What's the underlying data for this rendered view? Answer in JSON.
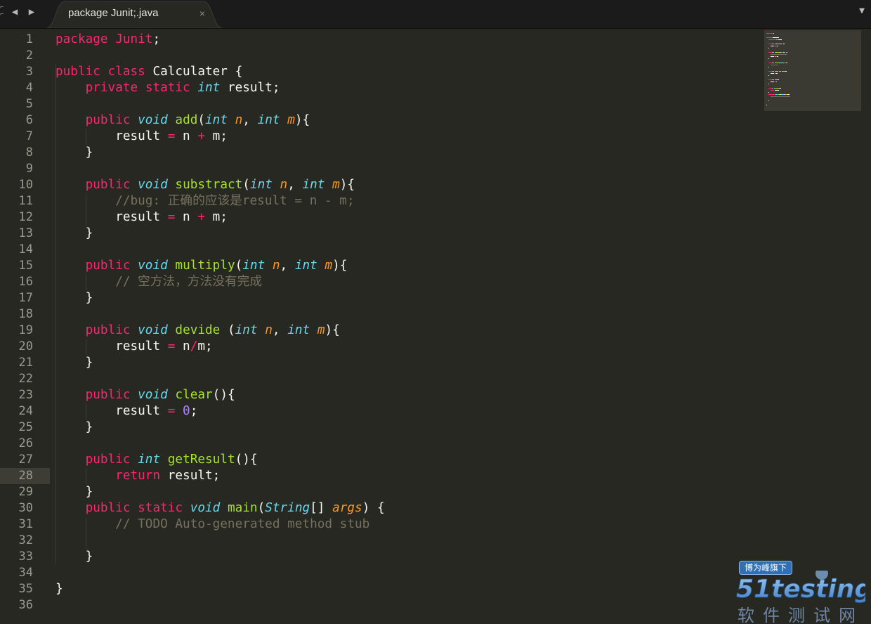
{
  "tab": {
    "title": "package Junit;.java",
    "close_glyph": "×",
    "prev_glyph": "◀",
    "next_glyph": "▶",
    "menu_glyph": "▼"
  },
  "editor": {
    "active_line": 28,
    "colors": {
      "background": "#272822",
      "keyword": "#f92672",
      "type": "#66d9ef",
      "function": "#a6e22e",
      "parameter": "#fd971f",
      "number": "#ae81ff",
      "comment": "#75715e",
      "text": "#f8f8f2"
    },
    "lines": [
      {
        "n": "1",
        "tokens": [
          [
            "kw",
            "package "
          ],
          [
            "kw",
            "Junit"
          ],
          [
            "plain",
            ";"
          ]
        ]
      },
      {
        "n": "2",
        "tokens": []
      },
      {
        "n": "3",
        "tokens": [
          [
            "kw",
            "public "
          ],
          [
            "kw",
            "class "
          ],
          [
            "plain",
            "Calculater {"
          ]
        ]
      },
      {
        "n": "4",
        "tokens": [
          [
            "plain",
            "    "
          ],
          [
            "kw",
            "private "
          ],
          [
            "kw",
            "static "
          ],
          [
            "type",
            "int"
          ],
          [
            "plain",
            " result;"
          ]
        ]
      },
      {
        "n": "5",
        "tokens": []
      },
      {
        "n": "6",
        "tokens": [
          [
            "plain",
            "    "
          ],
          [
            "kw",
            "public "
          ],
          [
            "type",
            "void"
          ],
          [
            "plain",
            " "
          ],
          [
            "fn",
            "add"
          ],
          [
            "plain",
            "("
          ],
          [
            "type",
            "int"
          ],
          [
            "plain",
            " "
          ],
          [
            "param",
            "n"
          ],
          [
            "plain",
            ", "
          ],
          [
            "type",
            "int"
          ],
          [
            "plain",
            " "
          ],
          [
            "param",
            "m"
          ],
          [
            "plain",
            "){"
          ]
        ]
      },
      {
        "n": "7",
        "tokens": [
          [
            "plain",
            "        result "
          ],
          [
            "op",
            "="
          ],
          [
            "plain",
            " n "
          ],
          [
            "op",
            "+"
          ],
          [
            "plain",
            " m;"
          ]
        ]
      },
      {
        "n": "8",
        "tokens": [
          [
            "plain",
            "    }"
          ]
        ]
      },
      {
        "n": "9",
        "tokens": []
      },
      {
        "n": "10",
        "tokens": [
          [
            "plain",
            "    "
          ],
          [
            "kw",
            "public "
          ],
          [
            "type",
            "void"
          ],
          [
            "plain",
            " "
          ],
          [
            "fn",
            "substract"
          ],
          [
            "plain",
            "("
          ],
          [
            "type",
            "int"
          ],
          [
            "plain",
            " "
          ],
          [
            "param",
            "n"
          ],
          [
            "plain",
            ", "
          ],
          [
            "type",
            "int"
          ],
          [
            "plain",
            " "
          ],
          [
            "param",
            "m"
          ],
          [
            "plain",
            "){"
          ]
        ]
      },
      {
        "n": "11",
        "tokens": [
          [
            "plain",
            "        "
          ],
          [
            "comment",
            "//bug: 正确的应该是result = n - m;"
          ]
        ]
      },
      {
        "n": "12",
        "tokens": [
          [
            "plain",
            "        result "
          ],
          [
            "op",
            "="
          ],
          [
            "plain",
            " n "
          ],
          [
            "op",
            "+"
          ],
          [
            "plain",
            " m;"
          ]
        ]
      },
      {
        "n": "13",
        "tokens": [
          [
            "plain",
            "    }"
          ]
        ]
      },
      {
        "n": "14",
        "tokens": []
      },
      {
        "n": "15",
        "tokens": [
          [
            "plain",
            "    "
          ],
          [
            "kw",
            "public "
          ],
          [
            "type",
            "void"
          ],
          [
            "plain",
            " "
          ],
          [
            "fn",
            "multiply"
          ],
          [
            "plain",
            "("
          ],
          [
            "type",
            "int"
          ],
          [
            "plain",
            " "
          ],
          [
            "param",
            "n"
          ],
          [
            "plain",
            ", "
          ],
          [
            "type",
            "int"
          ],
          [
            "plain",
            " "
          ],
          [
            "param",
            "m"
          ],
          [
            "plain",
            "){"
          ]
        ]
      },
      {
        "n": "16",
        "tokens": [
          [
            "plain",
            "        "
          ],
          [
            "comment",
            "// 空方法，方法没有完成"
          ]
        ]
      },
      {
        "n": "17",
        "tokens": [
          [
            "plain",
            "    }"
          ]
        ]
      },
      {
        "n": "18",
        "tokens": []
      },
      {
        "n": "19",
        "tokens": [
          [
            "plain",
            "    "
          ],
          [
            "kw",
            "public "
          ],
          [
            "type",
            "void"
          ],
          [
            "plain",
            " "
          ],
          [
            "fn",
            "devide"
          ],
          [
            "plain",
            " ("
          ],
          [
            "type",
            "int"
          ],
          [
            "plain",
            " "
          ],
          [
            "param",
            "n"
          ],
          [
            "plain",
            ", "
          ],
          [
            "type",
            "int"
          ],
          [
            "plain",
            " "
          ],
          [
            "param",
            "m"
          ],
          [
            "plain",
            "){"
          ]
        ]
      },
      {
        "n": "20",
        "tokens": [
          [
            "plain",
            "        result "
          ],
          [
            "op",
            "="
          ],
          [
            "plain",
            " n"
          ],
          [
            "op",
            "/"
          ],
          [
            "plain",
            "m;"
          ]
        ]
      },
      {
        "n": "21",
        "tokens": [
          [
            "plain",
            "    }"
          ]
        ]
      },
      {
        "n": "22",
        "tokens": []
      },
      {
        "n": "23",
        "tokens": [
          [
            "plain",
            "    "
          ],
          [
            "kw",
            "public "
          ],
          [
            "type",
            "void"
          ],
          [
            "plain",
            " "
          ],
          [
            "fn",
            "clear"
          ],
          [
            "plain",
            "(){"
          ]
        ]
      },
      {
        "n": "24",
        "tokens": [
          [
            "plain",
            "        result "
          ],
          [
            "op",
            "="
          ],
          [
            "plain",
            " "
          ],
          [
            "num",
            "0"
          ],
          [
            "plain",
            ";"
          ]
        ]
      },
      {
        "n": "25",
        "tokens": [
          [
            "plain",
            "    }"
          ]
        ]
      },
      {
        "n": "26",
        "tokens": []
      },
      {
        "n": "27",
        "tokens": [
          [
            "plain",
            "    "
          ],
          [
            "kw",
            "public "
          ],
          [
            "type",
            "int"
          ],
          [
            "plain",
            " "
          ],
          [
            "fn",
            "getResult"
          ],
          [
            "plain",
            "(){"
          ]
        ]
      },
      {
        "n": "28",
        "tokens": [
          [
            "plain",
            "        "
          ],
          [
            "kw",
            "return"
          ],
          [
            "plain",
            " result;"
          ]
        ]
      },
      {
        "n": "29",
        "tokens": [
          [
            "plain",
            "    }"
          ]
        ]
      },
      {
        "n": "30",
        "tokens": [
          [
            "plain",
            "    "
          ],
          [
            "kw",
            "public "
          ],
          [
            "kw",
            "static "
          ],
          [
            "type",
            "void"
          ],
          [
            "plain",
            " "
          ],
          [
            "fn",
            "main"
          ],
          [
            "plain",
            "("
          ],
          [
            "type",
            "String"
          ],
          [
            "plain",
            "[] "
          ],
          [
            "param",
            "args"
          ],
          [
            "plain",
            ") {"
          ]
        ]
      },
      {
        "n": "31",
        "tokens": [
          [
            "plain",
            "        "
          ],
          [
            "comment",
            "// TODO Auto-generated method stub"
          ]
        ]
      },
      {
        "n": "32",
        "tokens": []
      },
      {
        "n": "33",
        "tokens": [
          [
            "plain",
            "    }"
          ]
        ]
      },
      {
        "n": "34",
        "tokens": []
      },
      {
        "n": "35",
        "tokens": [
          [
            "plain",
            "}"
          ]
        ]
      },
      {
        "n": "36",
        "tokens": []
      }
    ]
  },
  "watermark": {
    "badge": "博为峰旗下",
    "logo_text": "51testing",
    "subtitle": "软件测试网"
  }
}
